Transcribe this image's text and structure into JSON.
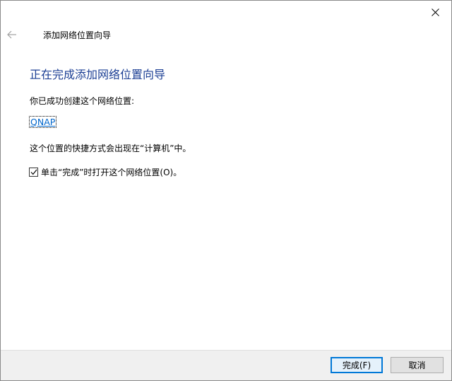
{
  "window": {
    "title": "添加网络位置向导"
  },
  "icons": {
    "close": "close-icon",
    "back": "back-arrow-icon",
    "checkbox": "checkmark-icon"
  },
  "content": {
    "heading": "正在完成添加网络位置向导",
    "success_text": "你已成功创建这个网络位置:",
    "location_name": "QNAP",
    "shortcut_text": "这个位置的快捷方式会出现在“计算机”中。",
    "open_checkbox": {
      "label": "单击“完成”时打开这个网络位置(O)。",
      "checked": true
    }
  },
  "buttons": {
    "finish_label": "完成(F)",
    "cancel_label": "取消"
  },
  "colors": {
    "heading": "#1c3f94",
    "link": "#0066cc",
    "accent": "#0078d7",
    "footer_bg": "#f0f0f0"
  }
}
